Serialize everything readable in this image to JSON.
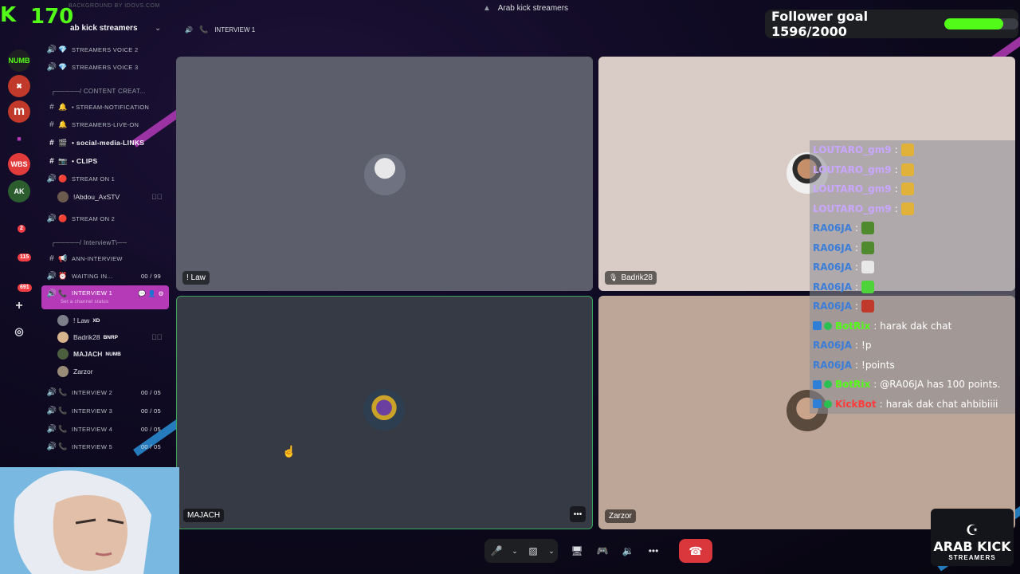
{
  "colors": {
    "accent": "#53fc18",
    "active_channel": "#b43ab8",
    "hangup": "#da373c"
  },
  "kick": {
    "logo": "K",
    "viewer_count": "170"
  },
  "faded_title": "BACKGROUND BY IDOVS.COM",
  "window_title": "Arab kick streamers",
  "goal": {
    "text": "Follower goal 1596/2000",
    "current": 1596,
    "target": 2000
  },
  "server": {
    "name": "ab kick streamers"
  },
  "breadcrumb": {
    "channel": "INTERVIEW 1"
  },
  "channels": [
    {
      "icon": "speaker-icon",
      "emoji": "💎",
      "label": "STREAMERS VOICE 2"
    },
    {
      "icon": "speaker-icon",
      "emoji": "💎",
      "label": "STREAMERS VOICE 3"
    },
    {
      "icon": "category",
      "emoji": "📹",
      "label": "┌─────/ CONTENT CREAT..."
    },
    {
      "icon": "hash-icon",
      "emoji": "🔔",
      "label": "• STREAM-NOTIFICATION"
    },
    {
      "icon": "hash-icon",
      "emoji": "🔔",
      "label": "STREAMERS-LIVE-ON"
    },
    {
      "icon": "hash-icon",
      "emoji": "🎬",
      "label": "• social-media-LINKS"
    },
    {
      "icon": "hash-icon",
      "emoji": "📷",
      "label": "• CLIPS"
    },
    {
      "icon": "speaker-icon",
      "emoji": "🔴",
      "label": "STREAM ON 1"
    },
    {
      "icon": "speaker-icon",
      "emoji": "🔴",
      "label": "STREAM ON 2"
    },
    {
      "icon": "category",
      "emoji": "",
      "label": "┌─────/ InterviewT\\──"
    },
    {
      "icon": "hash-icon",
      "emoji": "📢",
      "label": "ANN-INTERVIEW"
    },
    {
      "icon": "speaker-icon",
      "emoji": "⏰",
      "label": "WAITING IN...",
      "count": "00 / 99"
    },
    {
      "icon": "speaker-icon",
      "emoji": "📞",
      "label": "INTERVIEW 1",
      "status": "Set a channel status"
    },
    {
      "icon": "speaker-icon",
      "emoji": "📞",
      "label": "INTERVIEW 2",
      "count": "00 / 05"
    },
    {
      "icon": "speaker-icon",
      "emoji": "📞",
      "label": "INTERVIEW 3",
      "count": "00 / 05"
    },
    {
      "icon": "speaker-icon",
      "emoji": "📞",
      "label": "INTERVIEW 4",
      "count": "00 / 05"
    },
    {
      "icon": "speaker-icon",
      "emoji": "📞",
      "label": "INTERVIEW 5",
      "count": "00 / 05"
    }
  ],
  "stream_user": {
    "name": "!Abdou_AxSTV"
  },
  "voice_users": [
    {
      "name": "! Law",
      "tag": "XD"
    },
    {
      "name": "Badrik28",
      "tag": "BNRP"
    },
    {
      "name": "MAJACH",
      "tag": "NUMB"
    },
    {
      "name": "Zarzor",
      "tag": ""
    }
  ],
  "tiles": [
    {
      "name": "! Law"
    },
    {
      "name": "Badrik28"
    },
    {
      "name": "MAJACH"
    },
    {
      "name": "Zarzor"
    }
  ],
  "chat": [
    {
      "user": "LOUTARO_gm9",
      "color": "#c9a6ff",
      "text": "",
      "emote": "#e0b23a"
    },
    {
      "user": "LOUTARO_gm9",
      "color": "#c9a6ff",
      "text": "",
      "emote": "#e0b23a"
    },
    {
      "user": "LOUTARO_gm9",
      "color": "#c9a6ff",
      "text": "",
      "emote": "#e0b23a"
    },
    {
      "user": "LOUTARO_gm9",
      "color": "#c9a6ff",
      "text": "",
      "emote": "#e0b23a"
    },
    {
      "user": "RA06JA",
      "color": "#3b7dd8",
      "text": "",
      "emote": "#4f8a2e"
    },
    {
      "user": "RA06JA",
      "color": "#3b7dd8",
      "text": "",
      "emote": "#4f8a2e"
    },
    {
      "user": "RA06JA",
      "color": "#3b7dd8",
      "text": "",
      "emote": "#e8e8e8"
    },
    {
      "user": "RA06JA",
      "color": "#3b7dd8",
      "text": "",
      "emote": "#4ed33a"
    },
    {
      "user": "RA06JA",
      "color": "#3b7dd8",
      "text": "",
      "emote": "#c0392b"
    },
    {
      "user": "BotRix",
      "color": "#53fc18",
      "text": "harak dak chat",
      "bot": true
    },
    {
      "user": "RA06JA",
      "color": "#3b7dd8",
      "text": "!p"
    },
    {
      "user": "RA06JA",
      "color": "#3b7dd8",
      "text": "!points"
    },
    {
      "user": "BotRix",
      "color": "#53fc18",
      "text": "@RA06JA has 100 points.",
      "bot": true
    },
    {
      "user": "KickBot",
      "color": "#ff3b3b",
      "text": "harak dak chat ahbibiiii",
      "bot": true
    }
  ],
  "brand": {
    "line1": "ARAB KICK",
    "line2": "STREAMERS"
  },
  "rail_badges": [
    "2",
    "115",
    "691"
  ]
}
